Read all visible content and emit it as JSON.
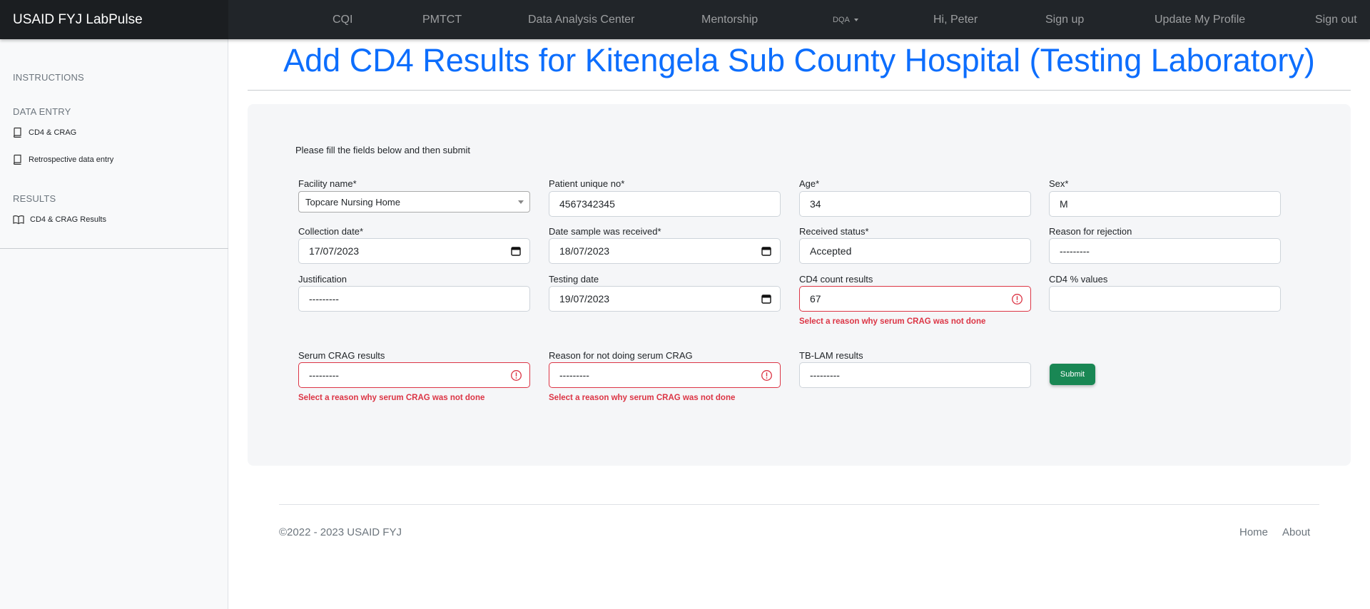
{
  "brand": "USAID FYJ LabPulse",
  "nav": {
    "items": [
      "CQI",
      "PMTCT",
      "Data Analysis Center",
      "Mentorship"
    ],
    "dqa": "DQA",
    "greeting": "Hi, Peter",
    "signup": "Sign up",
    "profile": "Update My Profile",
    "signout": "Sign out"
  },
  "sidebar": {
    "instructions": "INSTRUCTIONS",
    "data_entry": "DATA ENTRY",
    "cd4_crag": "CD4 & CRAG",
    "retro": "Retrospective data entry",
    "results": "RESULTS",
    "cd4_results": "CD4 & CRAG Results"
  },
  "page_title": "Add CD4 Results for Kitengela Sub County Hospital (Testing Laboratory)",
  "instructions": "Please fill the fields below and then submit",
  "form": {
    "facility": {
      "label": "Facility name*",
      "value": "Topcare Nursing Home"
    },
    "patient_no": {
      "label": "Patient unique no*",
      "value": "4567342345"
    },
    "age": {
      "label": "Age*",
      "value": "34"
    },
    "sex": {
      "label": "Sex*",
      "value": "M"
    },
    "collection_date": {
      "label": "Collection date*",
      "value": "17/07/2023"
    },
    "received_date": {
      "label": "Date sample was received*",
      "value": "18/07/2023"
    },
    "received_status": {
      "label": "Received status*",
      "value": "Accepted"
    },
    "rejection_reason": {
      "label": "Reason for rejection",
      "value": "---------"
    },
    "justification": {
      "label": "Justification",
      "value": "---------"
    },
    "testing_date": {
      "label": "Testing date",
      "value": "19/07/2023"
    },
    "cd4_count": {
      "label": "CD4 count results",
      "value": "67",
      "error": "Select a reason why serum CRAG was not done"
    },
    "cd4_percent": {
      "label": "CD4 % values",
      "value": ""
    },
    "serum_crag": {
      "label": "Serum CRAG results",
      "value": "---------",
      "error": "Select a reason why serum CRAG was not done"
    },
    "no_crag_reason": {
      "label": "Reason for not doing serum CRAG",
      "value": "---------",
      "error": "Select a reason why serum CRAG was not done"
    },
    "tb_lam": {
      "label": "TB-LAM results",
      "value": "---------"
    },
    "submit": "Submit"
  },
  "footer": {
    "copyright": "©2022 - 2023 USAID FYJ",
    "home": "Home",
    "about": "About"
  },
  "colors": {
    "primary": "#0d6efd",
    "danger": "#dc3545",
    "success": "#198754",
    "navbar": "#212529"
  }
}
